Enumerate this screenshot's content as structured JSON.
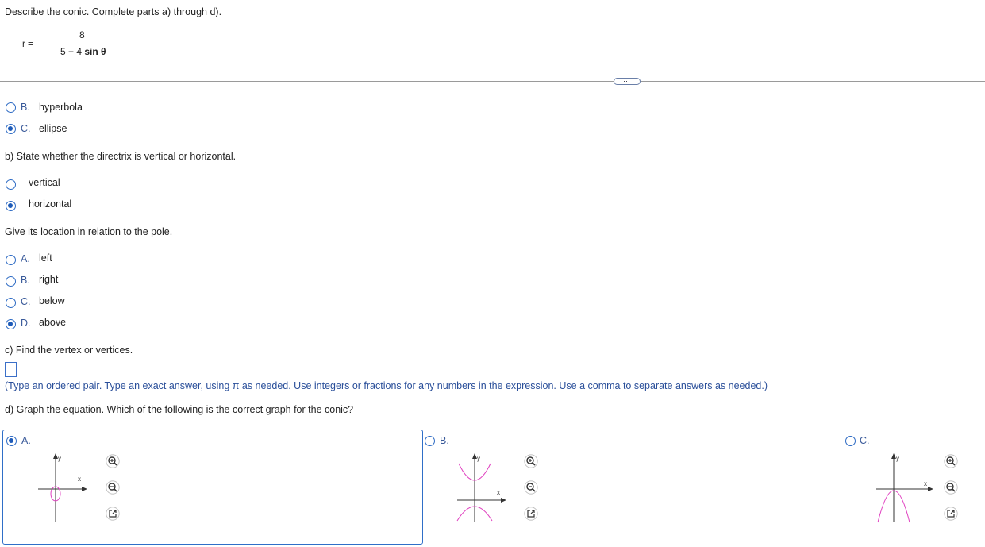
{
  "question": {
    "instruction": "Describe the conic. Complete parts a) through d).",
    "equation": {
      "lhs": "r =",
      "numerator": "8",
      "denominator_prefix": "5 + 4 ",
      "denominator_func": "sin θ"
    }
  },
  "more_button": "⋯",
  "part_a": {
    "options": [
      {
        "letter": "B.",
        "label": "hyperbola",
        "selected": false
      },
      {
        "letter": "C.",
        "label": "ellipse",
        "selected": true
      }
    ]
  },
  "part_b": {
    "prompt": "b) State whether the directrix is vertical or horizontal.",
    "options": [
      {
        "label": "vertical",
        "selected": false
      },
      {
        "label": "horizontal",
        "selected": true
      }
    ],
    "location_prompt": "Give its location in relation to the pole.",
    "location_options": [
      {
        "letter": "A.",
        "label": "left",
        "selected": false
      },
      {
        "letter": "B.",
        "label": "right",
        "selected": false
      },
      {
        "letter": "C.",
        "label": "below",
        "selected": false
      },
      {
        "letter": "D.",
        "label": "above",
        "selected": true
      }
    ]
  },
  "part_c": {
    "prompt": "c) Find the vertex or vertices.",
    "answer_value": "",
    "hint": "(Type an ordered pair. Type an exact answer, using π as needed. Use integers or fractions for any numbers in the expression. Use a comma to separate answers as needed.)"
  },
  "part_d": {
    "prompt": "d) Graph the equation. Which of the following is the correct graph for the conic?",
    "graphs": [
      {
        "letter": "A.",
        "selected": true,
        "shape": "ellipse",
        "x_axis_label": "x",
        "y_axis_label": "y"
      },
      {
        "letter": "B.",
        "selected": false,
        "shape": "hyperbola",
        "x_axis_label": "x",
        "y_axis_label": "y"
      },
      {
        "letter": "C.",
        "selected": false,
        "shape": "parabola",
        "x_axis_label": "x",
        "y_axis_label": "y"
      }
    ],
    "tool_icons": [
      "zoom-in-icon",
      "zoom-out-icon",
      "open-external-icon"
    ],
    "curve_color": "#e040c0",
    "axis_color": "#333333"
  },
  "colors": {
    "accent": "#2e6bc4",
    "hint_text": "#2a4f9a",
    "divider": "#9a9a9a"
  }
}
